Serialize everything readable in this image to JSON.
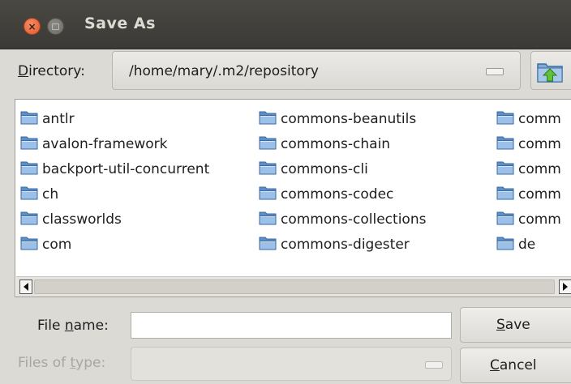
{
  "window": {
    "title": "Save As",
    "close_glyph": "×",
    "close_icon": "close-icon",
    "minimize_icon": "minimize-icon"
  },
  "directory": {
    "label_mnemonic": "D",
    "label_rest": "irectory:",
    "path": "/home/mary/.m2/repository",
    "up_icon": "folder-up-icon"
  },
  "file_list": {
    "columns": [
      [
        "antlr",
        "avalon-framework",
        "backport-util-concurrent",
        "ch",
        "classworlds",
        "com"
      ],
      [
        "commons-beanutils",
        "commons-chain",
        "commons-cli",
        "commons-codec",
        "commons-collections",
        "commons-digester"
      ],
      [
        "comm",
        "comm",
        "comm",
        "comm",
        "comm",
        "de"
      ]
    ],
    "item_icon": "folder-icon"
  },
  "file_name": {
    "label_before": "File ",
    "label_mnemonic": "n",
    "label_after": "ame:",
    "value": ""
  },
  "file_type": {
    "label_before": "Files of ",
    "label_mnemonic": "t",
    "label_after": "ype:",
    "value": ""
  },
  "buttons": {
    "save_mnemonic": "S",
    "save_rest": "ave",
    "cancel_mnemonic": "C",
    "cancel_rest": "ancel"
  },
  "colors": {
    "titlebar": "#3f3e3a",
    "close_button": "#e66a3d",
    "dialog_bg": "#dcdad5",
    "folder_blue": "#6f9fd0"
  }
}
